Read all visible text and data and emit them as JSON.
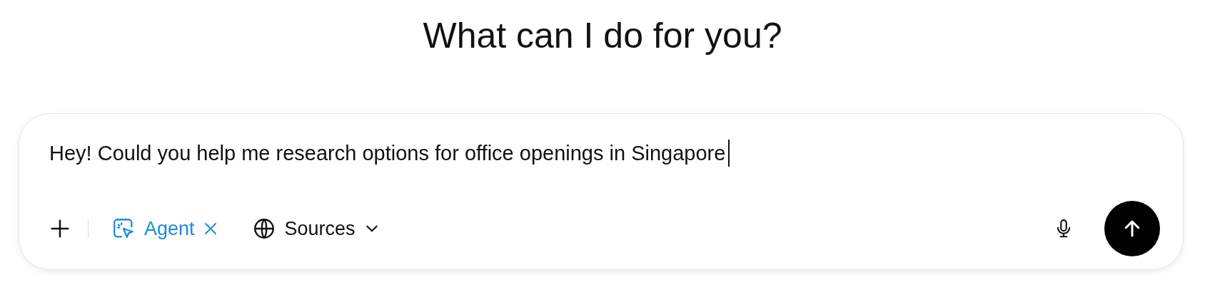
{
  "heading": "What can I do for you?",
  "composer": {
    "value": "Hey! Could you help me research options for office openings in Singapore",
    "tools": [
      {
        "kind": "chip",
        "label": "Agent",
        "active": true,
        "removable": true
      },
      {
        "kind": "dropdown",
        "label": "Sources",
        "active": false
      }
    ]
  }
}
